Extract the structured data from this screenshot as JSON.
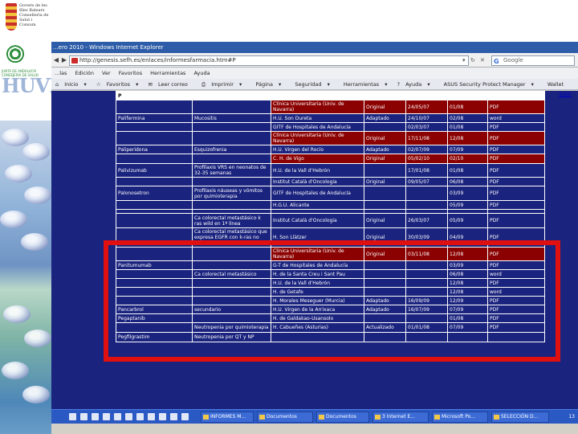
{
  "sidebar": {
    "logo1_text": "Govern de les Illes Balears Conselleria de Salut i Consum",
    "logo2_text": "JUNTA DE ANDALUCÍA CONSEJERÍA DE SALUD",
    "logo3_text": "HUVR"
  },
  "browser": {
    "title": "...ero 2010 - Windows Internet Explorer",
    "url": "http://genesis.sefh.es/enlaces/informesfarmacia.htm#P",
    "search_placeholder": "Google",
    "menus": [
      "...las",
      "Edición",
      "Ver",
      "Favoritos",
      "Herramientas",
      "Ayuda"
    ],
    "toolbar": [
      "Inicio",
      "Favoritos",
      "Leer correo",
      "Imprimir",
      "Página",
      "Seguridad",
      "Herramientas",
      "Ayuda",
      "ASUS Security Protect Manager",
      "Wallet"
    ]
  },
  "table": {
    "letter": "P",
    "subir": "Subir",
    "rows": [
      {
        "drug": "",
        "ind": "",
        "center": "Clínica Universitaria (Univ. de Navarra)",
        "type": "Original",
        "date": "24/05/07",
        "ver": "01/08",
        "fmt": "PDF",
        "hl": true
      },
      {
        "drug": "Palifermina",
        "ind": "Mucositis",
        "center": "H.U. Son Dureta",
        "type": "Adaptado",
        "date": "24/10/07",
        "ver": "02/08",
        "fmt": "word",
        "hl": false
      },
      {
        "drug": "",
        "ind": "",
        "center": "GITF de Hospitales de Andalucía",
        "type": "",
        "date": "02/03/07",
        "ver": "01/08",
        "fmt": "PDF",
        "hl": false
      },
      {
        "drug": "",
        "ind": "",
        "center": "Clínica Universitaria (Univ. de Navarra)",
        "type": "Original",
        "date": "17/11/08",
        "ver": "12/08",
        "fmt": "PDF",
        "hl": true
      },
      {
        "drug": "Paliperidona",
        "ind": "Esquizofrenia",
        "center": "H.U. Virgen del Rocío",
        "type": "Adaptado",
        "date": "02/07/09",
        "ver": "07/09",
        "fmt": "PDF",
        "hl": false
      },
      {
        "drug": "",
        "ind": "",
        "center": "C. H. de Vigo",
        "type": "Original",
        "date": "05/02/10",
        "ver": "02/10",
        "fmt": "PDF",
        "hl": true,
        "nuevo": true
      },
      {
        "drug": "Palivizumab",
        "ind": "Profilaxis VRS en neonatos de 32-35 semanas",
        "center": "H.U. de la Vall d'Hebrón",
        "type": "",
        "date": "17/01/08",
        "ver": "01/08",
        "fmt": "PDF",
        "hl": false
      },
      {
        "drug": "",
        "ind": "",
        "center": "Institut Català d'Oncologia",
        "type": "Original",
        "date": "09/05/07",
        "ver": "06/08",
        "fmt": "PDF",
        "hl": false
      },
      {
        "drug": "Palonosetron",
        "ind": "Profilaxis náuseas y vómitos por quimioterapia",
        "center": "GITF de Hospitales de Andalucía",
        "type": "",
        "date": "",
        "ver": "03/09",
        "fmt": "PDF",
        "hl": false
      },
      {
        "drug": "",
        "ind": "",
        "center": "H.G.U. Alicante",
        "type": "",
        "date": "",
        "ver": "05/09",
        "fmt": "PDF",
        "hl": false
      },
      {
        "drug": "",
        "ind": "",
        "center": "",
        "type": "",
        "date": "",
        "ver": "",
        "fmt": "",
        "hl": false
      },
      {
        "drug": "",
        "ind": "Ca colorectal metastásico k ras wild en 1ª línea",
        "center": "Institut Català d'Oncologia",
        "type": "Original",
        "date": "26/03/07",
        "ver": "05/09",
        "fmt": "PDF",
        "hl": false
      },
      {
        "drug": "",
        "ind": "Ca colorectal metastásico que expresa EGFR con k-ras no mutado",
        "center": "H. Son Llàtzer",
        "type": "Original",
        "date": "30/03/09",
        "ver": "04/09",
        "fmt": "PDF",
        "hl": false
      },
      {
        "drug": "",
        "ind": "",
        "center": "Clínica Universitaria (Univ. de Navarra)",
        "type": "Original",
        "date": "03/11/08",
        "ver": "12/08",
        "fmt": "PDF",
        "hl": true
      },
      {
        "drug": "Panitumumab",
        "ind": "",
        "center": "G-T de Hospitales de Andalucía",
        "type": "",
        "date": "",
        "ver": "03/09",
        "fmt": "PDF",
        "hl": false
      },
      {
        "drug": "",
        "ind": "Ca colorectal metastásico",
        "center": "H. de la Santa Creu i Sant Pau",
        "type": "",
        "date": "",
        "ver": "06/08",
        "fmt": "word",
        "hl": false
      },
      {
        "drug": "",
        "ind": "",
        "center": "H.U. de la Vall d'Hebrón",
        "type": "",
        "date": "",
        "ver": "12/08",
        "fmt": "PDF",
        "hl": false
      },
      {
        "drug": "",
        "ind": "",
        "center": "H. de Getafe",
        "type": "",
        "date": "",
        "ver": "12/08",
        "fmt": "word",
        "hl": false
      },
      {
        "drug": "",
        "ind": "",
        "center": "H. Morales Meseguer (Murcia)",
        "type": "Adaptado",
        "date": "16/09/09",
        "ver": "12/09",
        "fmt": "PDF",
        "hl": false
      },
      {
        "drug": "Pancarbrol",
        "ind": "secundario",
        "center": "H.U. Virgen de la Arrixaca",
        "type": "Adaptado",
        "date": "16/07/09",
        "ver": "07/09",
        "fmt": "PDF",
        "hl": false
      },
      {
        "drug": "Pegaptanib",
        "ind": "",
        "center": "H. de Galdakao-Usansolo",
        "type": "",
        "date": "",
        "ver": "01/08",
        "fmt": "PDF",
        "hl": false
      },
      {
        "drug": "",
        "ind": "Neutropenia por quimioterapia",
        "center": "H. Cabueñes (Asturias)",
        "type": "Actualizado",
        "date": "01/01/08",
        "ver": "07/09",
        "fmt": "PDF",
        "hl": false
      },
      {
        "drug": "Pegfilgrastim",
        "ind": "Neutropenia por QT y NP",
        "center": "",
        "type": "",
        "date": "",
        "ver": "",
        "fmt": "",
        "hl": false
      }
    ]
  },
  "taskbar": {
    "buttons": [
      "INFORMES M...",
      "Documentos",
      "Documentos",
      "3 Internet E...",
      "Microsoft Po...",
      "SELECCIÓN D..."
    ],
    "clock": "13"
  }
}
